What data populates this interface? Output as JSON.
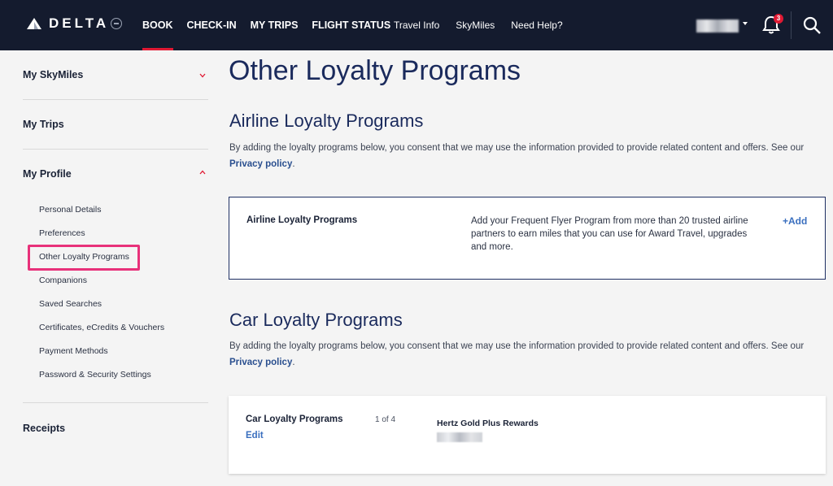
{
  "header": {
    "brand": "DELTA",
    "nav_primary": [
      "BOOK",
      "CHECK-IN",
      "MY TRIPS",
      "FLIGHT STATUS"
    ],
    "nav_secondary": [
      "Travel Info",
      "SkyMiles",
      "Need Help?"
    ],
    "notification_count": "3"
  },
  "sidebar": {
    "sections": {
      "skymiles": "My SkyMiles",
      "trips": "My Trips",
      "profile": "My Profile",
      "receipts": "Receipts"
    },
    "profile_items": [
      "Personal Details",
      "Preferences",
      "Other Loyalty Programs",
      "Companions",
      "Saved Searches",
      "Certificates, eCredits & Vouchers",
      "Payment Methods",
      "Password & Security Settings"
    ]
  },
  "main": {
    "page_title": "Other Loyalty Programs",
    "airline": {
      "heading": "Airline Loyalty Programs",
      "consent": "By adding the loyalty programs below, you consent that we may use the information provided to provide related content and offers. See our",
      "privacy_link": "Privacy policy",
      "period": ".",
      "card_title": "Airline Loyalty Programs",
      "card_desc": "Add your Frequent Flyer Program from more than 20 trusted airline partners to earn miles that you can use for Award Travel, upgrades and more.",
      "add_label": "+Add"
    },
    "car": {
      "heading": "Car Loyalty Programs",
      "consent": "By adding the loyalty programs below, you consent that we may use the information provided to provide related content and offers. See our",
      "privacy_link": "Privacy policy",
      "period": ".",
      "card_title": "Car Loyalty Programs",
      "edit_label": "Edit",
      "count": "1 of 4",
      "program_name": "Hertz Gold Plus Rewards"
    }
  },
  "colors": {
    "header_bg": "#141b2e",
    "accent_red": "#e01933",
    "highlight_pink": "#e8317a",
    "link_blue": "#3a6fbf",
    "heading_navy": "#1a2a5c"
  }
}
